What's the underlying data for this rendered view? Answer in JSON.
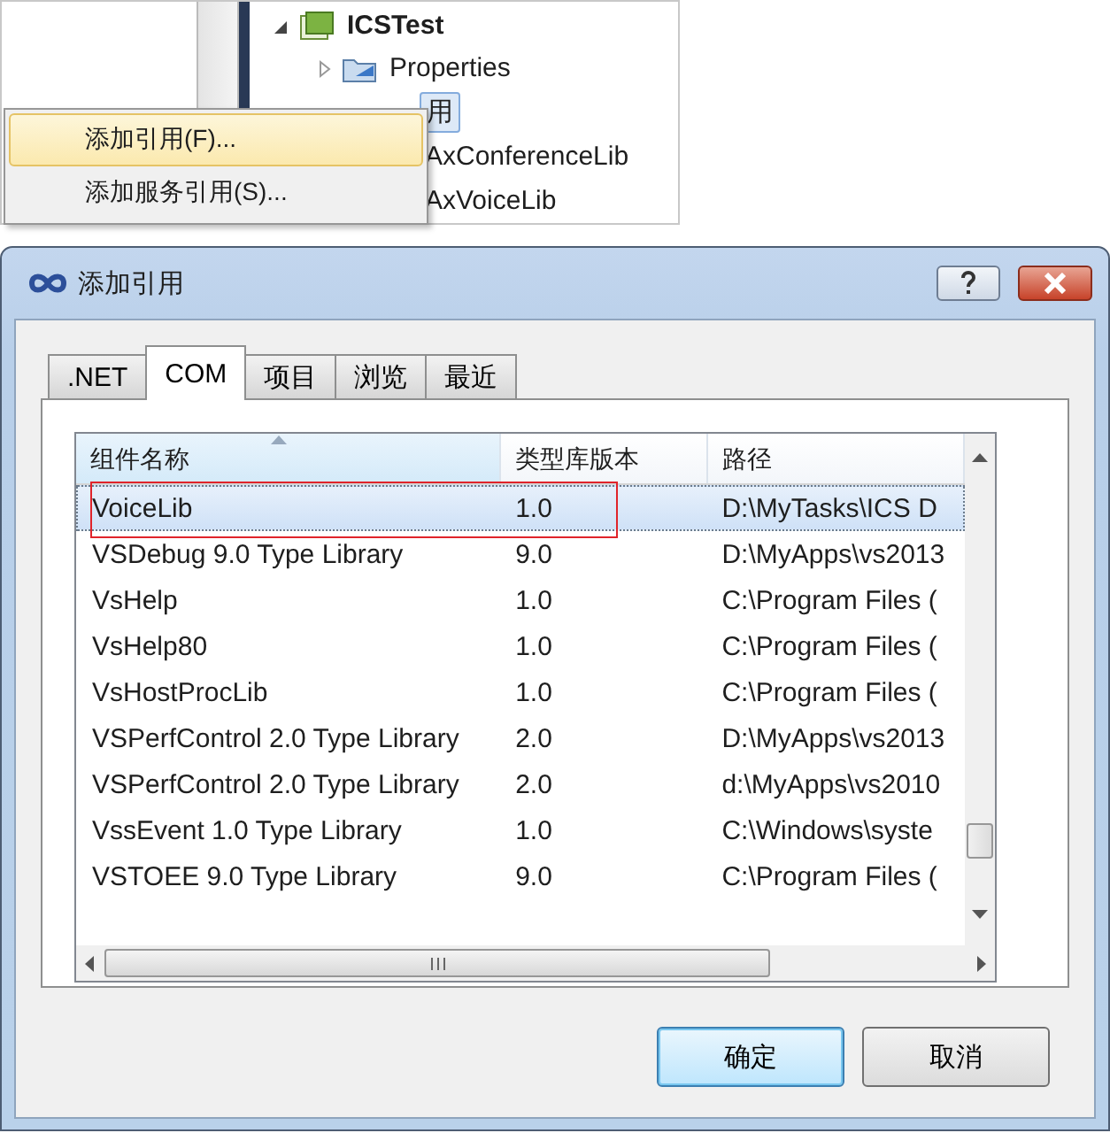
{
  "solution_tree": [
    {
      "label": "ICSTest",
      "expanded": true,
      "selected": false,
      "children": [
        {
          "label": "Properties",
          "expanded": false,
          "selected": false
        },
        {
          "label": "用",
          "selected": true,
          "children": [
            {
              "label": "AxConferenceLib",
              "selected": false
            },
            {
              "label": "AxVoiceLib",
              "selected": false
            }
          ]
        }
      ]
    }
  ],
  "context_menu": [
    {
      "label": "添加引用(F)...",
      "selected": true
    },
    {
      "label": "添加服务引用(S)...",
      "selected": false
    }
  ],
  "dialog": {
    "title": "添加引用",
    "tabs": [
      {
        "label": ".NET",
        "selected": false
      },
      {
        "label": "COM",
        "selected": true
      },
      {
        "label": "项目",
        "selected": false
      },
      {
        "label": "浏览",
        "selected": false
      },
      {
        "label": "最近",
        "selected": false
      }
    ],
    "table": {
      "columns": [
        {
          "label": "组件名称",
          "sorted": true
        },
        {
          "label": "类型库版本",
          "sorted": false
        },
        {
          "label": "路径",
          "sorted": false
        }
      ],
      "rows": [
        {
          "cells": [
            "VoiceLib",
            "1.0",
            "D:\\MyTasks\\ICS D"
          ],
          "selected": true
        },
        {
          "cells": [
            "VSDebug 9.0 Type Library",
            "9.0",
            "D:\\MyApps\\vs2013"
          ],
          "selected": false
        },
        {
          "cells": [
            "VsHelp",
            "1.0",
            "C:\\Program Files ("
          ],
          "selected": false
        },
        {
          "cells": [
            "VsHelp80",
            "1.0",
            "C:\\Program Files ("
          ],
          "selected": false
        },
        {
          "cells": [
            "VsHostProcLib",
            "1.0",
            "C:\\Program Files ("
          ],
          "selected": false
        },
        {
          "cells": [
            "VSPerfControl 2.0 Type Library",
            "2.0",
            "D:\\MyApps\\vs2013"
          ],
          "selected": false
        },
        {
          "cells": [
            "VSPerfControl 2.0 Type Library",
            "2.0",
            "d:\\MyApps\\vs2010"
          ],
          "selected": false
        },
        {
          "cells": [
            "VssEvent 1.0 Type Library",
            "1.0",
            "C:\\Windows\\syste"
          ],
          "selected": false
        },
        {
          "cells": [
            "VSTOEE 9.0 Type Library",
            "9.0",
            "C:\\Program Files ("
          ],
          "selected": false
        }
      ]
    },
    "buttons": [
      {
        "label": "确定",
        "default": true
      },
      {
        "label": "取消",
        "default": false
      }
    ]
  }
}
